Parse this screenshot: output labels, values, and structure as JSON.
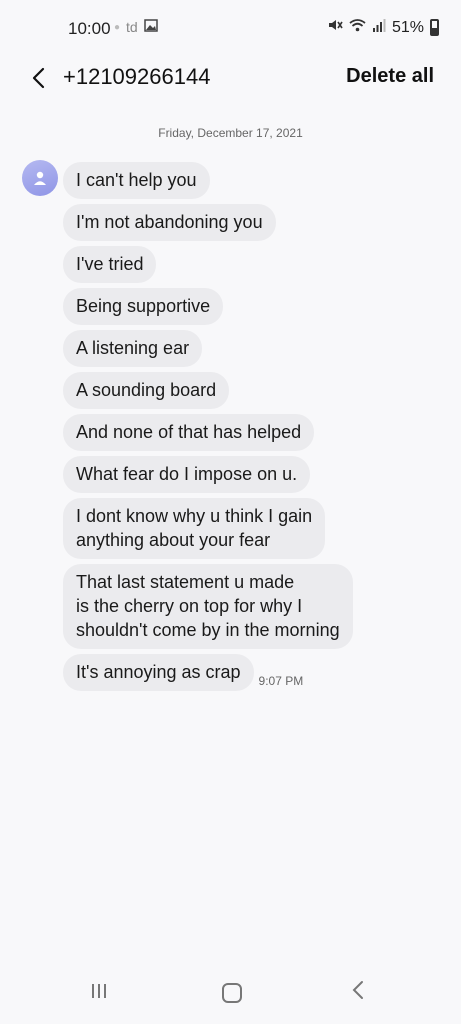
{
  "status_bar": {
    "time": "10:00",
    "left_text": "td",
    "battery": "51%"
  },
  "header": {
    "contact": "+12109266144",
    "delete_all": "Delete all"
  },
  "date_separator": "Friday, December 17, 2021",
  "messages": [
    {
      "text": "I can't help you"
    },
    {
      "text": "I'm not abandoning you"
    },
    {
      "text": "I've tried"
    },
    {
      "text": "Being supportive"
    },
    {
      "text": "A listening ear"
    },
    {
      "text": "A sounding board"
    },
    {
      "text": "And none of that has helped"
    },
    {
      "text": "What fear do I impose on u."
    },
    {
      "text": "I dont know why u think I gain\nanything about your fear"
    },
    {
      "text": "That last statement u made\nis the cherry on top for why I\nshouldn't come by in the morning"
    },
    {
      "text": "It's annoying as crap",
      "time": "9:07 PM"
    }
  ],
  "icons": {
    "back": "chevron-left-icon",
    "avatar": "person-icon",
    "status": [
      "mute-icon",
      "wifi-icon",
      "signal-icon",
      "battery-icon",
      "image-icon"
    ],
    "nav": [
      "recent-apps-icon",
      "home-icon",
      "nav-back-icon"
    ]
  }
}
